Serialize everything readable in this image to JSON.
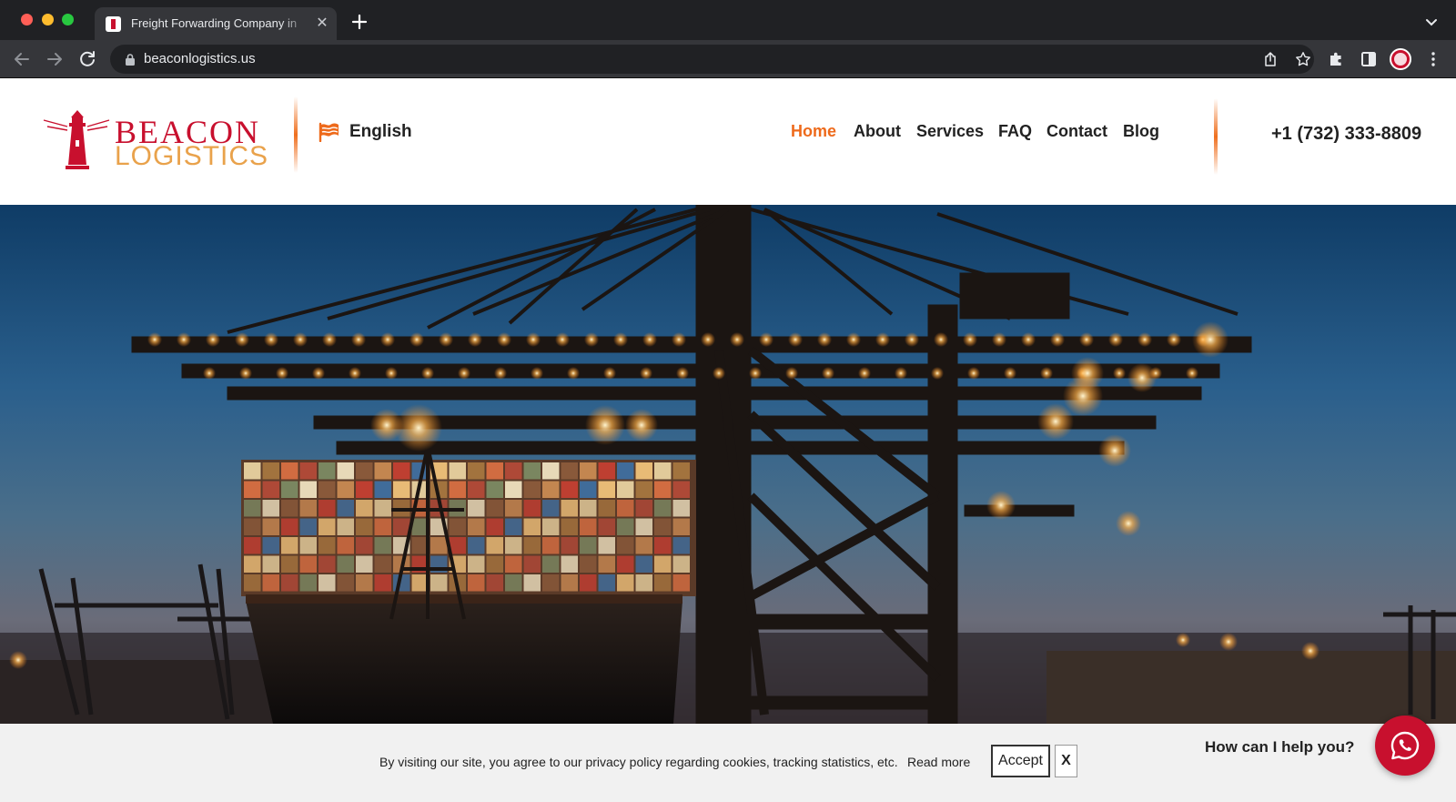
{
  "browser": {
    "tab_title": "Freight Forwarding Company in",
    "tab_close": "✕",
    "url": "beaconlogistics.us"
  },
  "header": {
    "logo": {
      "word1": "BEACON",
      "word2": "LOGISTICS"
    },
    "language": "English",
    "nav": [
      {
        "label": "Home",
        "active": true
      },
      {
        "label": "About"
      },
      {
        "label": "Services"
      },
      {
        "label": "FAQ"
      },
      {
        "label": "Contact"
      },
      {
        "label": "Blog"
      }
    ],
    "phone": "+1 (732) 333-8809"
  },
  "cookie_bar": {
    "text": "By visiting our site, you agree to our privacy policy regarding cookies, tracking statistics, etc.",
    "read_more": "Read more",
    "accept": "Accept",
    "close": "X"
  },
  "chat": {
    "prompt": "How can I help you?",
    "icon": "whatsapp-icon"
  },
  "colors": {
    "brand_red": "#c8102e",
    "brand_gold": "#e9a24b",
    "nav_active": "#ee6a1b"
  }
}
